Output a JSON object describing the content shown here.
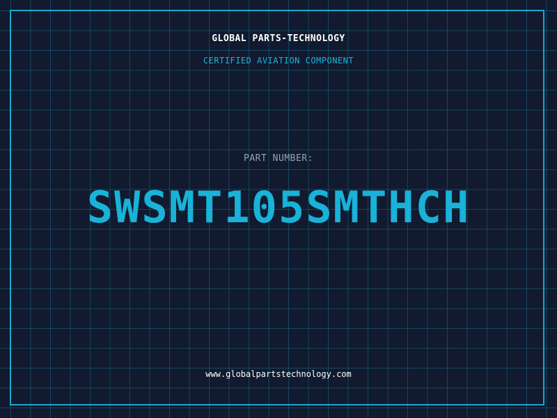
{
  "header": {
    "company": "GLOBAL PARTS-TECHNOLOGY",
    "tagline": "CERTIFIED AVIATION COMPONENT"
  },
  "part": {
    "label": "PART NUMBER:",
    "number": "SWSMT105SMTHCH"
  },
  "footer": {
    "url": "www.globalpartstechnology.com"
  },
  "colors": {
    "background": "#111a2e",
    "accent": "#19b2d8",
    "grid": "#159abe"
  }
}
